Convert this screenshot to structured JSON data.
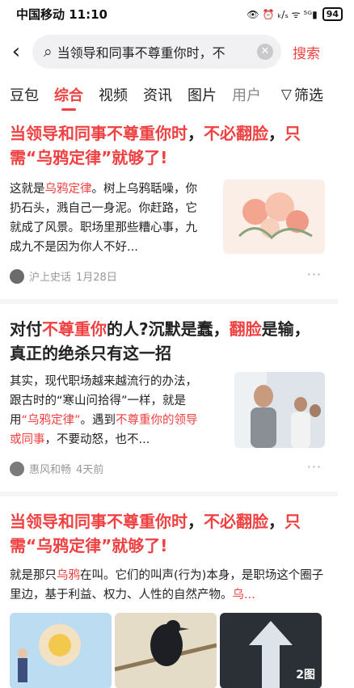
{
  "status_bar": {
    "carrier_time": "中国移动 11:10",
    "icons": "👁 ⏰ ₖ/ₛ ᯤ ⁵ᴳ▮",
    "battery": "94"
  },
  "search": {
    "value": "当领导和同事不尊重你时，不",
    "submit_label": "搜索"
  },
  "tabs": [
    {
      "label": "豆包"
    },
    {
      "label": "综合"
    },
    {
      "label": "视频"
    },
    {
      "label": "资讯"
    },
    {
      "label": "图片"
    },
    {
      "label": "用户"
    }
  ],
  "filter_label": "筛选",
  "cards": [
    {
      "title_1": "当领导和同事不尊重你时",
      "title_2": "，",
      "title_3": "不必翻脸",
      "title_4": "，",
      "title_5": "只需“乌鸦定律”就够了!",
      "snippet_1": "这就是",
      "snippet_2": "乌鸦定律",
      "snippet_3": "。树上乌鸦聒噪，你扔石头，溅自己一身泥。你赶路，它就成了风景。职场里那些糟心事，九成九不是因为你人不好...",
      "author": "沪上史话",
      "date": "1月28日",
      "more": "···"
    },
    {
      "title_1": "对付",
      "title_2": "不尊重你",
      "title_3": "的人?沉默是蠢，",
      "title_4": "翻脸",
      "title_5": "是输，真正的绝杀只有这一招",
      "snippet_1": "其实，现代职场越来越流行的办法，跟古时的“寒山问拾得”一样，就是用",
      "snippet_2": "“乌鸦定律”",
      "snippet_3": "。遇到",
      "snippet_4": "不尊重你的领导或同事",
      "snippet_5": "，不要动怒，也不...",
      "author": "惠风和畅",
      "date": "4天前",
      "more": "···"
    },
    {
      "title_1": "当领导和同事不尊重你时",
      "title_2": "，",
      "title_3": "不必翻脸",
      "title_4": "，",
      "title_5": "只需“乌鸦定律”就够了!",
      "snippet_1": "就是那只",
      "snippet_2": "乌鸦",
      "snippet_3": "在叫。它们的叫声(行为)本身，是职场这个圈子里边，基于利益、权力、人性的自然产物。",
      "snippet_4": "乌...",
      "image_count": "2图"
    }
  ]
}
